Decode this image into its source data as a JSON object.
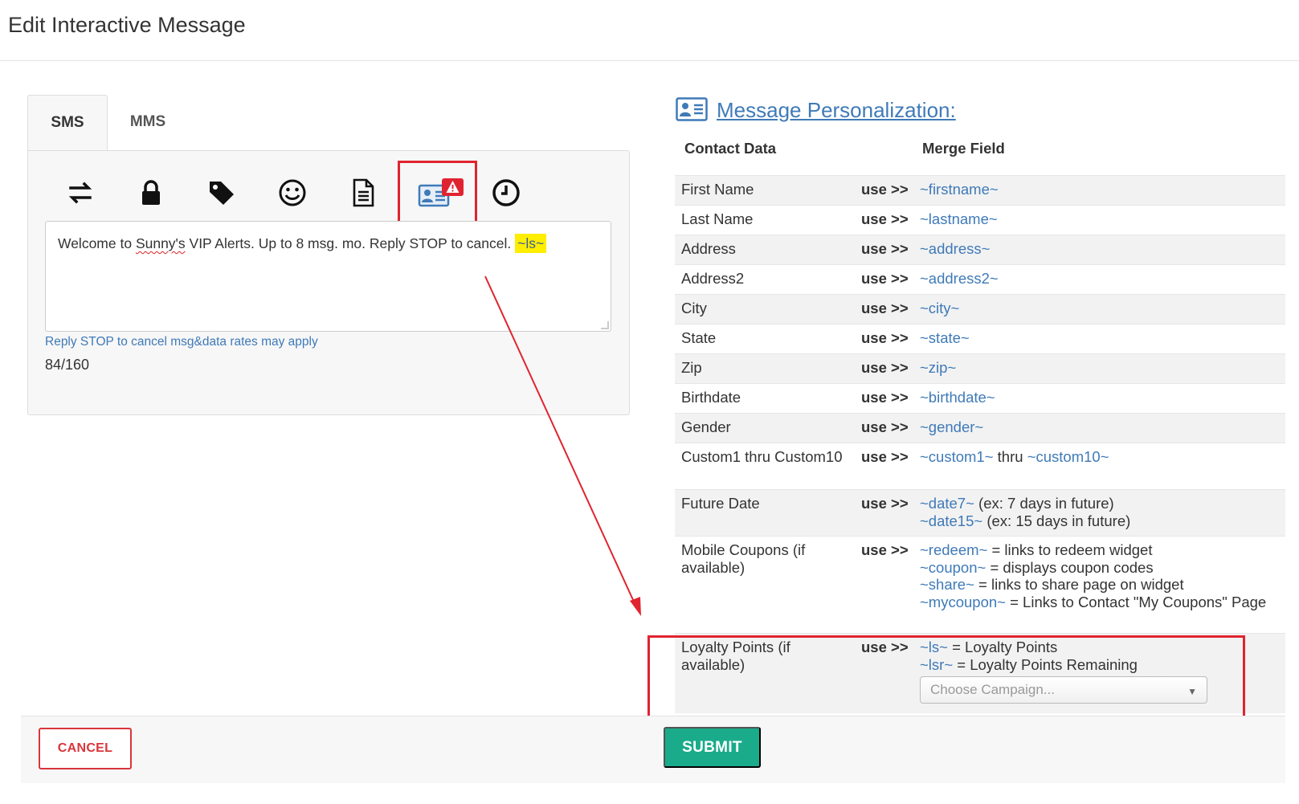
{
  "page": {
    "title": "Edit Interactive Message"
  },
  "tabs": [
    {
      "label": "SMS",
      "active": true
    },
    {
      "label": "MMS",
      "active": false
    }
  ],
  "toolbar": [
    {
      "icon": "exchange-icon"
    },
    {
      "icon": "lock-icon"
    },
    {
      "icon": "tag-icon"
    },
    {
      "icon": "smiley-icon"
    },
    {
      "icon": "document-icon"
    },
    {
      "icon": "contact-card-warning-icon"
    },
    {
      "icon": "clock-icon"
    }
  ],
  "message": {
    "text_part1": "Welcome to ",
    "misspelled": "Sunny's",
    "text_part2": " VIP Alerts. Up to 8 msg. mo. Reply STOP to cancel. ",
    "highlighted": "~ls~"
  },
  "hint": "Reply STOP to cancel msg&data rates may apply",
  "char_count": "84/160",
  "personalization": {
    "title": "Message Personalization:",
    "col_contact": "Contact Data",
    "col_merge": "Merge Field",
    "use_label": "use >>",
    "rows": [
      {
        "label": "First Name",
        "lines": [
          {
            "field": "~firstname~",
            "desc": ""
          }
        ]
      },
      {
        "label": "Last Name",
        "lines": [
          {
            "field": "~lastname~",
            "desc": ""
          }
        ]
      },
      {
        "label": "Address",
        "lines": [
          {
            "field": "~address~",
            "desc": ""
          }
        ]
      },
      {
        "label": "Address2",
        "lines": [
          {
            "field": "~address2~",
            "desc": ""
          }
        ]
      },
      {
        "label": "City",
        "lines": [
          {
            "field": "~city~",
            "desc": ""
          }
        ]
      },
      {
        "label": "State",
        "lines": [
          {
            "field": "~state~",
            "desc": ""
          }
        ]
      },
      {
        "label": "Zip",
        "lines": [
          {
            "field": "~zip~",
            "desc": ""
          }
        ]
      },
      {
        "label": "Birthdate",
        "lines": [
          {
            "field": "~birthdate~",
            "desc": ""
          }
        ]
      },
      {
        "label": "Gender",
        "lines": [
          {
            "field": "~gender~",
            "desc": ""
          }
        ]
      },
      {
        "label": "Custom1 thru Custom10",
        "lines": [
          {
            "field": "~custom1~",
            "desc": " thru ",
            "field2": "~custom10~"
          }
        ]
      },
      {
        "label": "Future Date",
        "lines": [
          {
            "field": "~date7~",
            "desc": " (ex: 7 days in future)"
          },
          {
            "field": "~date15~",
            "desc": " (ex: 15 days in future)"
          }
        ]
      },
      {
        "label": "Mobile Coupons (if available)",
        "lines": [
          {
            "field": "~redeem~",
            "desc": " = links to redeem widget"
          },
          {
            "field": "~coupon~",
            "desc": " = displays coupon codes"
          },
          {
            "field": "~share~",
            "desc": " = links to share page on widget"
          },
          {
            "field": "~mycoupon~",
            "desc": " = Links to Contact \"My Coupons\" Page"
          }
        ]
      },
      {
        "label": "Loyalty Points (if available)",
        "lines": [
          {
            "field": "~ls~",
            "desc": " = Loyalty Points"
          },
          {
            "field": "~lsr~",
            "desc": " = Loyalty Points Remaining"
          }
        ],
        "select": {
          "placeholder": "Choose Campaign..."
        }
      }
    ]
  },
  "buttons": {
    "cancel": "CANCEL",
    "submit": "SUBMIT"
  },
  "colors": {
    "link": "#3f7ab8",
    "highlight_box": "#e0242f",
    "submit": "#1aab8b",
    "cancel": "#d9353a",
    "marker": "#ffee00"
  }
}
